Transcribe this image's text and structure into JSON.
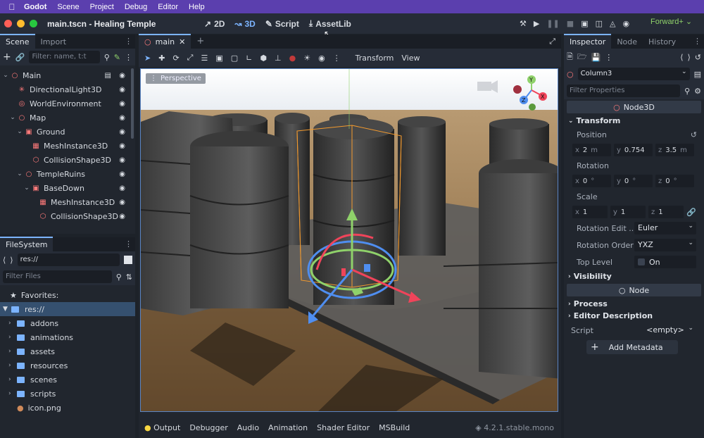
{
  "menubar": {
    "app_name": "Godot",
    "items": [
      "Scene",
      "Project",
      "Debug",
      "Editor",
      "Help"
    ]
  },
  "titlebar": {
    "title": "main.tscn - Healing Temple",
    "modes": [
      "2D",
      "3D",
      "Script",
      "AssetLib"
    ],
    "active_mode": "3D",
    "renderer": "Forward+"
  },
  "scene_panel": {
    "tabs": [
      "Scene",
      "Import"
    ],
    "filter_placeholder": "Filter: name, t:t",
    "nodes": [
      {
        "label": "Main",
        "depth": 0,
        "expanded": true,
        "icon_color": "#ff7a7a",
        "icon": "node3d-icon",
        "has_script": true
      },
      {
        "label": "DirectionalLight3D",
        "depth": 1,
        "icon_color": "#ff7a7a",
        "icon": "light-icon"
      },
      {
        "label": "WorldEnvironment",
        "depth": 1,
        "icon_color": "#ff7a7a",
        "icon": "globe-icon"
      },
      {
        "label": "Map",
        "depth": 1,
        "expanded": true,
        "icon_color": "#ff7a7a",
        "icon": "node3d-icon"
      },
      {
        "label": "Ground",
        "depth": 2,
        "expanded": true,
        "icon_color": "#ff7a7a",
        "icon": "staticbody-icon"
      },
      {
        "label": "MeshInstance3D",
        "depth": 3,
        "icon_color": "#ff7a7a",
        "icon": "mesh-icon"
      },
      {
        "label": "CollisionShape3D",
        "depth": 3,
        "icon_color": "#ff7a7a",
        "icon": "collision-icon"
      },
      {
        "label": "TempleRuins",
        "depth": 2,
        "expanded": true,
        "icon_color": "#ff7a7a",
        "icon": "node3d-icon"
      },
      {
        "label": "BaseDown",
        "depth": 3,
        "expanded": true,
        "icon_color": "#ff7a7a",
        "icon": "staticbody-icon"
      },
      {
        "label": "MeshInstance3D",
        "depth": 4,
        "icon_color": "#ff7a7a",
        "icon": "mesh-icon"
      },
      {
        "label": "CollisionShape3D",
        "depth": 4,
        "icon_color": "#ff7a7a",
        "icon": "collision-icon"
      }
    ]
  },
  "filesystem": {
    "tab": "FileSystem",
    "path": "res://",
    "filter_placeholder": "Filter Files",
    "favorites_label": "Favorites:",
    "root": "res://",
    "folders": [
      "addons",
      "animations",
      "assets",
      "resources",
      "scenes",
      "scripts"
    ],
    "files": [
      "icon.png"
    ]
  },
  "viewport": {
    "tab": "main",
    "menus": [
      "Transform",
      "View"
    ],
    "perspective_label": "Perspective",
    "bottom_tabs": [
      "Output",
      "Debugger",
      "Audio",
      "Animation",
      "Shader Editor",
      "MSBuild"
    ],
    "version": "4.2.1.stable.mono"
  },
  "inspector": {
    "tabs": [
      "Inspector",
      "Node",
      "History"
    ],
    "object": "Column3",
    "filter_placeholder": "Filter Properties",
    "class_header": "Node3D",
    "transform_label": "Transform",
    "position_label": "Position",
    "position": {
      "x": "2",
      "y": "0.754",
      "z": "3.5",
      "unit": "m"
    },
    "rotation_label": "Rotation",
    "rotation": {
      "x": "0",
      "y": "0",
      "z": "0",
      "unit": "°"
    },
    "scale_label": "Scale",
    "scale": {
      "x": "1",
      "y": "1",
      "z": "1"
    },
    "rotation_edit_label": "Rotation Edit ...",
    "rotation_edit_value": "Euler",
    "rotation_order_label": "Rotation Order",
    "rotation_order_value": "YXZ",
    "top_level_label": "Top Level",
    "top_level_value": "On",
    "visibility_label": "Visibility",
    "node_header": "Node",
    "process_label": "Process",
    "editor_description_label": "Editor Description",
    "script_label": "Script",
    "script_value": "<empty>",
    "add_metadata_label": "Add Metadata"
  },
  "colors": {
    "accent": "#7cb4ff",
    "menubar": "#5b3fae",
    "renderer": "#8fd16a",
    "node_red": "#ff7a7a",
    "selection_orange": "#f39a2e"
  }
}
